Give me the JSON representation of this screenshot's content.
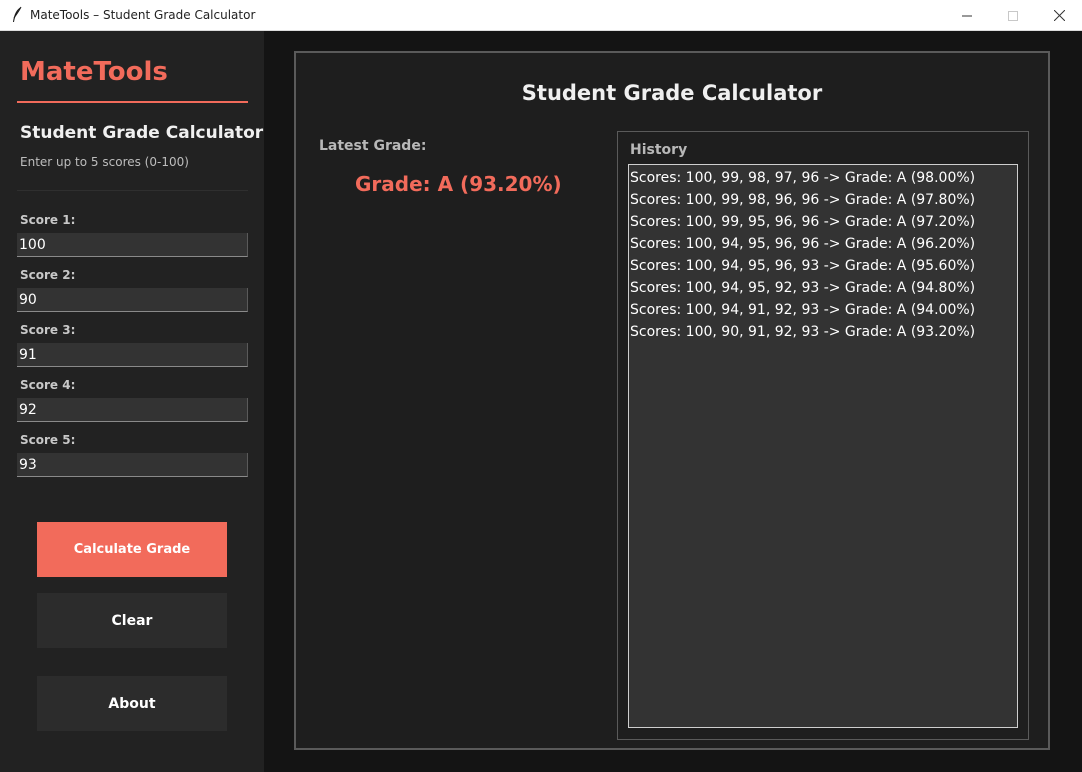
{
  "window": {
    "title": "MateTools – Student Grade Calculator"
  },
  "sidebar": {
    "logo": "MateTools",
    "title": "Student Grade Calculator",
    "subtitle": "Enter up to 5 scores (0-100)",
    "scores": [
      {
        "label": "Score 1:",
        "value": "100"
      },
      {
        "label": "Score 2:",
        "value": "90"
      },
      {
        "label": "Score 3:",
        "value": "91"
      },
      {
        "label": "Score 4:",
        "value": "92"
      },
      {
        "label": "Score 5:",
        "value": "93"
      }
    ],
    "buttons": {
      "calculate": "Calculate Grade",
      "clear": "Clear",
      "about": "About"
    }
  },
  "main": {
    "title": "Student Grade Calculator",
    "latest_label": "Latest Grade:",
    "latest_grade": "Grade: A (93.20%)",
    "history_label": "History",
    "history": [
      "Scores: 100, 99, 98, 97, 96 -> Grade: A (98.00%)",
      "Scores: 100, 99, 98, 96, 96 -> Grade: A (97.80%)",
      "Scores: 100, 99, 95, 96, 96 -> Grade: A (97.20%)",
      "Scores: 100, 94, 95, 96, 96 -> Grade: A (96.20%)",
      "Scores: 100, 94, 95, 96, 93 -> Grade: A (95.60%)",
      "Scores: 100, 94, 95, 92, 93 -> Grade: A (94.80%)",
      "Scores: 100, 94, 91, 92, 93 -> Grade: A (94.00%)",
      "Scores: 100, 90, 91, 92, 93 -> Grade: A (93.20%)"
    ]
  },
  "colors": {
    "accent": "#f26b5b",
    "sidebar_bg": "#222222",
    "panel_bg": "#1e1e1e",
    "input_bg": "#333333"
  }
}
